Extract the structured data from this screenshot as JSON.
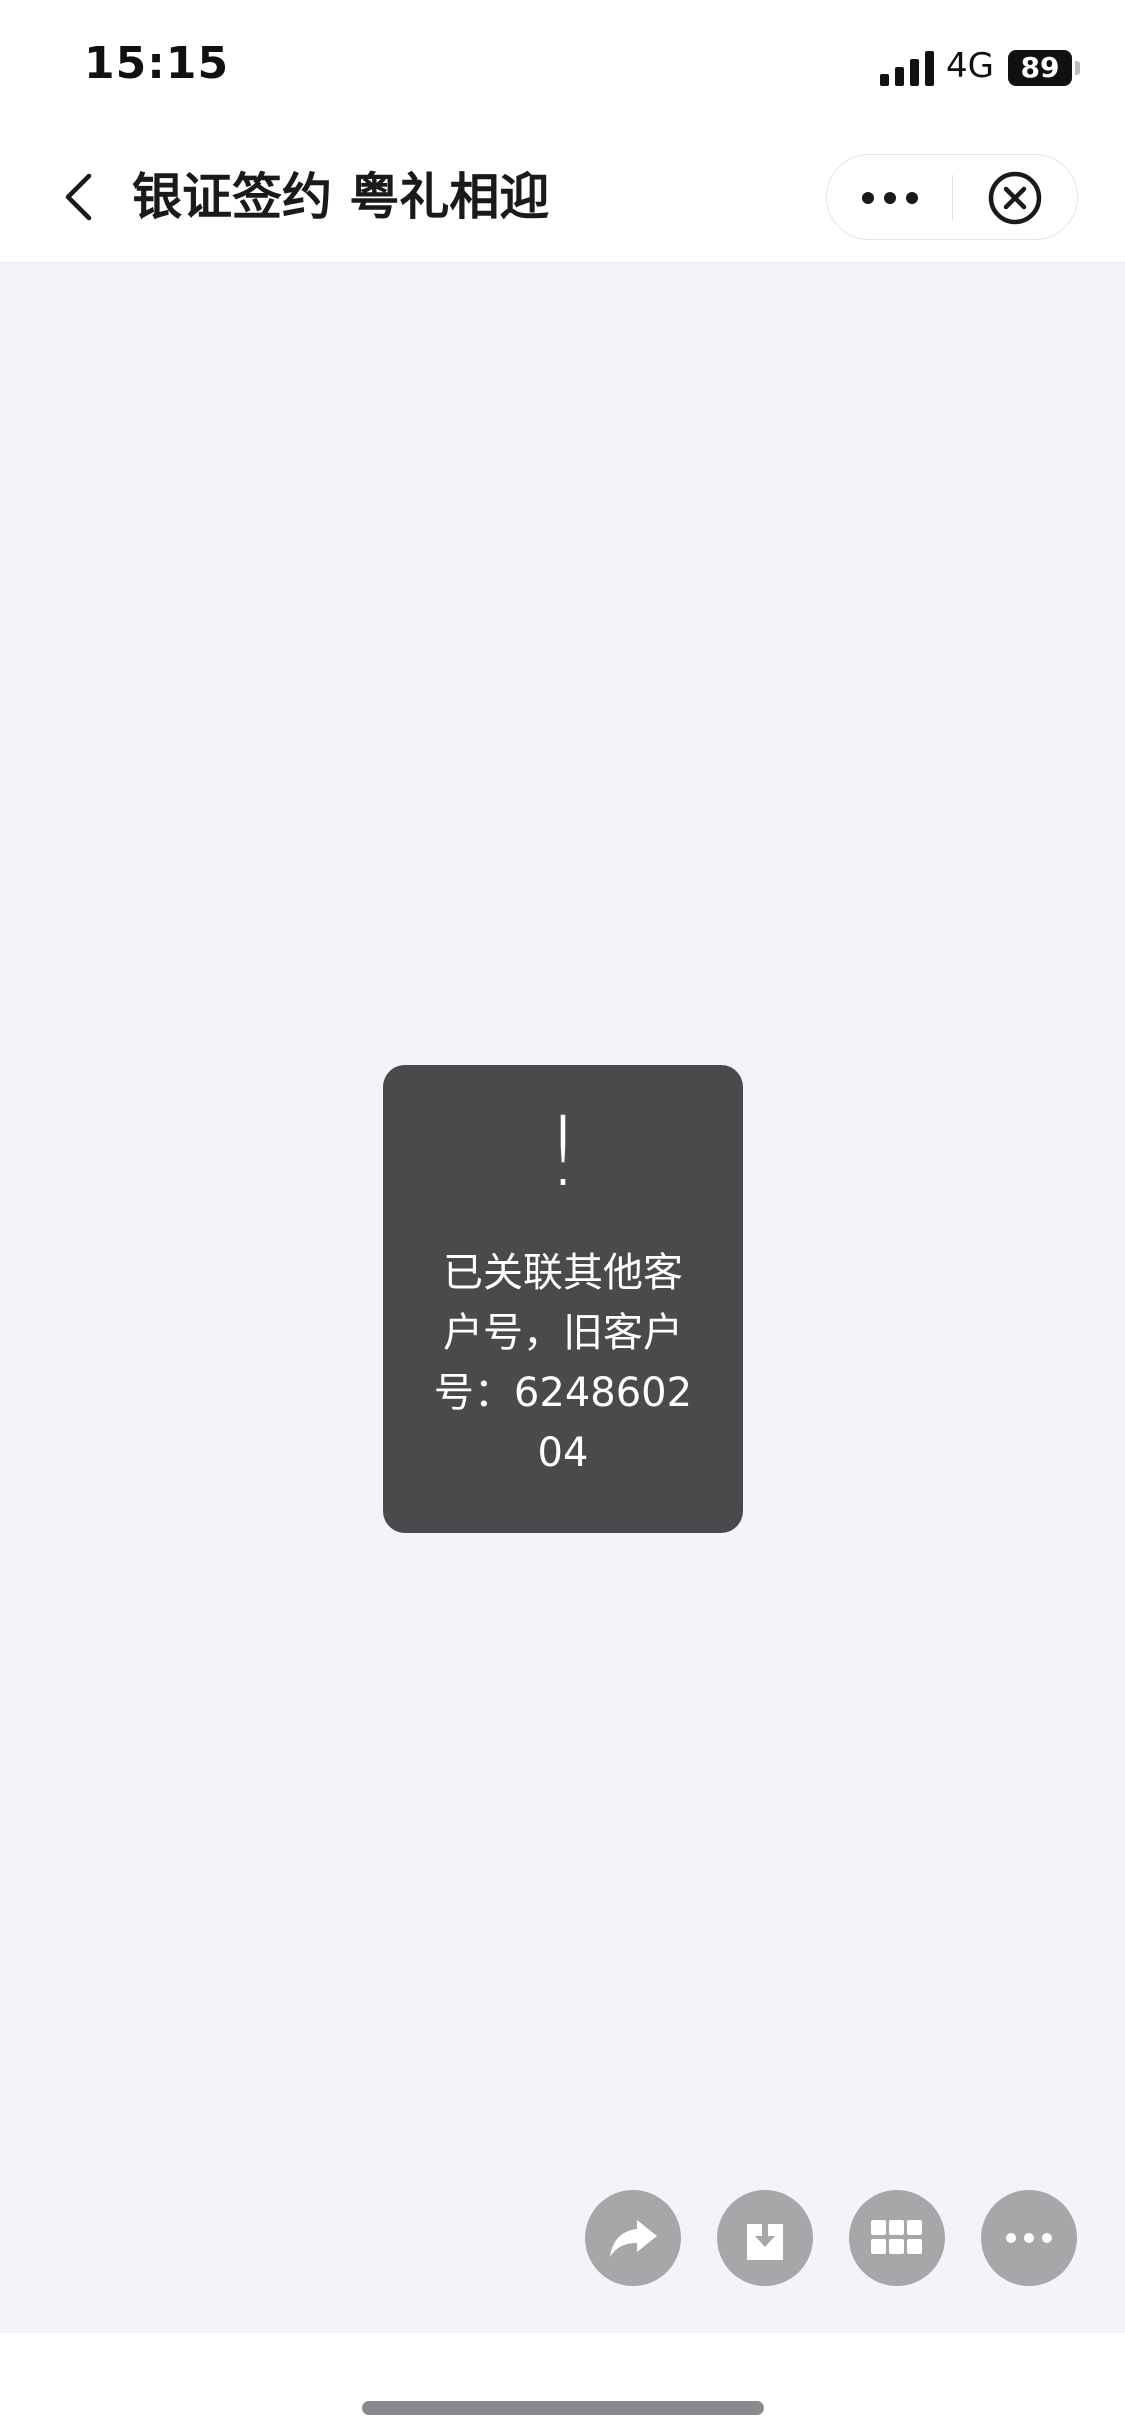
{
  "status_bar": {
    "time": "15:15",
    "network": "4G",
    "battery": "89"
  },
  "nav": {
    "title": "银证签约 粤礼相迎"
  },
  "toast": {
    "icon": "!",
    "message": "已关联其他客户号，旧客户号：624860204"
  },
  "icons": {
    "back": "chevron-left-icon",
    "more": "ellipsis-icon",
    "close": "circle-x-icon",
    "share": "share-arrow-icon",
    "save": "download-icon",
    "grid": "grid-icon",
    "more_actions": "ellipsis-icon"
  },
  "colors": {
    "page_background": "#f3f4f9",
    "toast_background": "#4a4a4d",
    "fab_background": "#a7a7aa"
  }
}
